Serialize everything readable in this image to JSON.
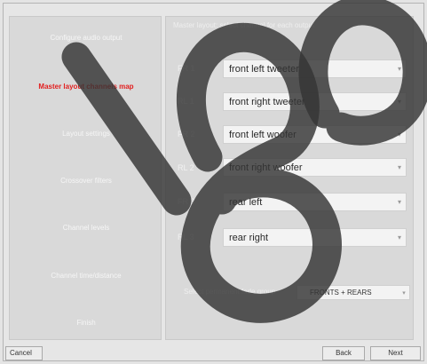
{
  "sidebar": {
    "items": [
      {
        "label": "Configure audio output"
      },
      {
        "label": "Master layout channels map"
      },
      {
        "label": "Layout settings"
      },
      {
        "label": "Crossover filters"
      },
      {
        "label": "Channel levels"
      },
      {
        "label": "Channel time/distance"
      },
      {
        "label": "Finish"
      }
    ]
  },
  "main": {
    "heading": "Master layout: select channel for each output",
    "channels": [
      {
        "label": "FR 1",
        "value": "front left tweeter"
      },
      {
        "label": "RL 1",
        "value": "front right tweeter"
      },
      {
        "label": "FR 2",
        "value": "front left woofer"
      },
      {
        "label": "RL 2",
        "value": "front right woofer"
      },
      {
        "label": "FR 3",
        "value": "rear left"
      },
      {
        "label": "RL 3",
        "value": "rear right"
      }
    ],
    "group_label": "Select permanent fade group",
    "group_value": "FRONTS + REARS"
  },
  "buttons": {
    "cancel": "Cancel",
    "back": "Back",
    "next": "Next"
  },
  "icons": {
    "dropdown": "chevron-down-icon"
  },
  "colors": {
    "active_item": "#e21f1f",
    "panel": "#d9d9d9",
    "watermark": "#333333"
  }
}
